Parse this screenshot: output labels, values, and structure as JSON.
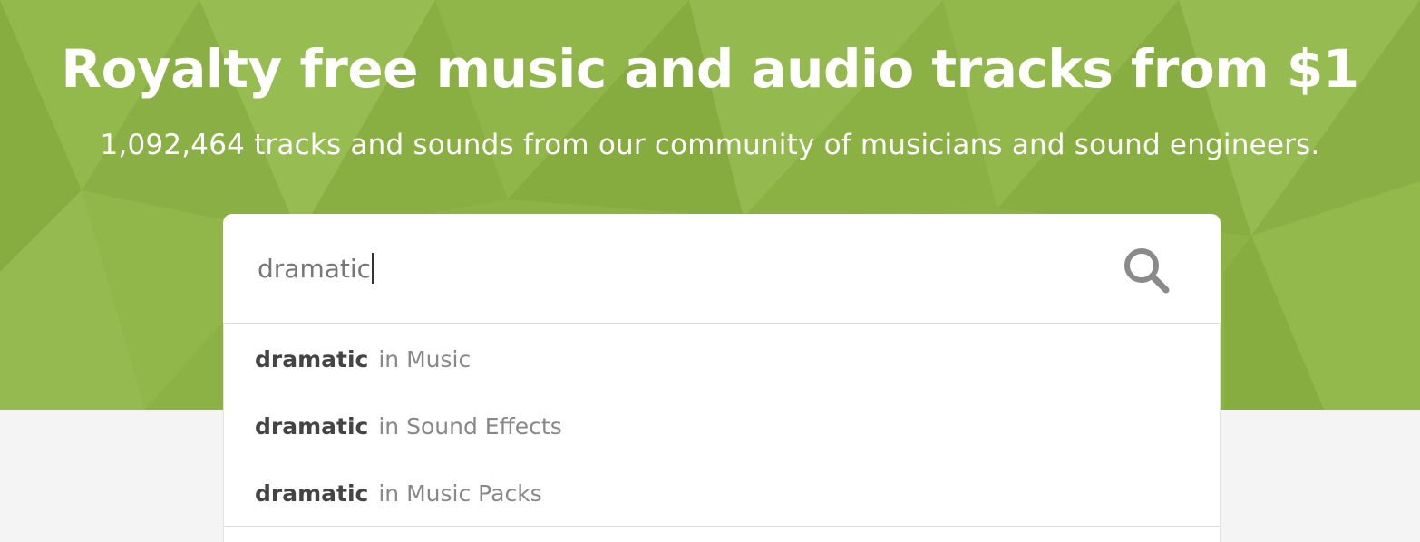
{
  "hero": {
    "headline": "Royalty free music and audio tracks from $1",
    "subline": "1,092,464 tracks and sounds from our community of musicians and sound engineers."
  },
  "search": {
    "value": "dramatic",
    "icon": "search-icon"
  },
  "suggestions": [
    {
      "term": "dramatic",
      "scope": "in Music"
    },
    {
      "term": "dramatic",
      "scope": "in Sound Effects"
    },
    {
      "term": "dramatic",
      "scope": "in Music Packs"
    }
  ],
  "colors": {
    "hero_green": "#8db347",
    "page_background": "#f4f4f4",
    "text_white": "#ffffff",
    "suggestion_term": "#444444",
    "suggestion_scope": "#888888",
    "search_icon": "#8a8a8a"
  }
}
